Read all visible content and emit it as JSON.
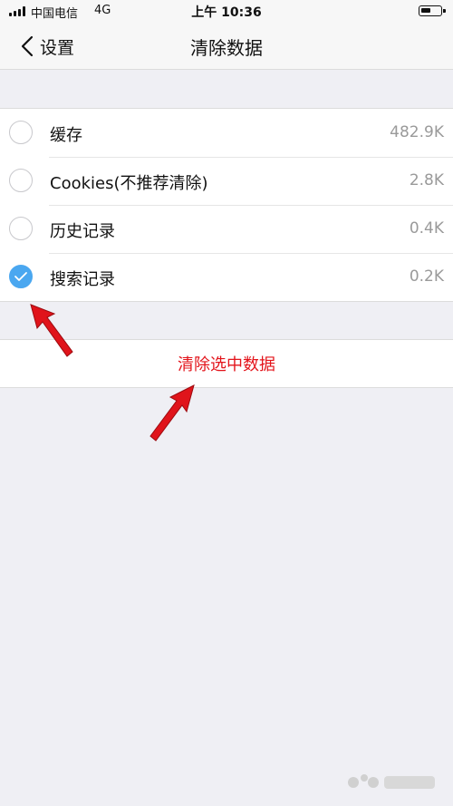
{
  "status_bar": {
    "carrier": "中国电信",
    "network": "4G",
    "time": "上午 10:36"
  },
  "nav": {
    "back_label": "设置",
    "title": "清除数据"
  },
  "items": [
    {
      "label": "缓存",
      "size": "482.9K",
      "checked": false
    },
    {
      "label": "Cookies(不推荐清除)",
      "size": "2.8K",
      "checked": false
    },
    {
      "label": "历史记录",
      "size": "0.4K",
      "checked": false
    },
    {
      "label": "搜索记录",
      "size": "0.2K",
      "checked": true
    }
  ],
  "action": {
    "label": "清除选中数据"
  },
  "colors": {
    "accent": "#4aa7f0",
    "danger": "#e3141b",
    "annotation_arrow": "#e0141b"
  },
  "watermark": {
    "logo_name": "baidu-jingyan-logo"
  }
}
